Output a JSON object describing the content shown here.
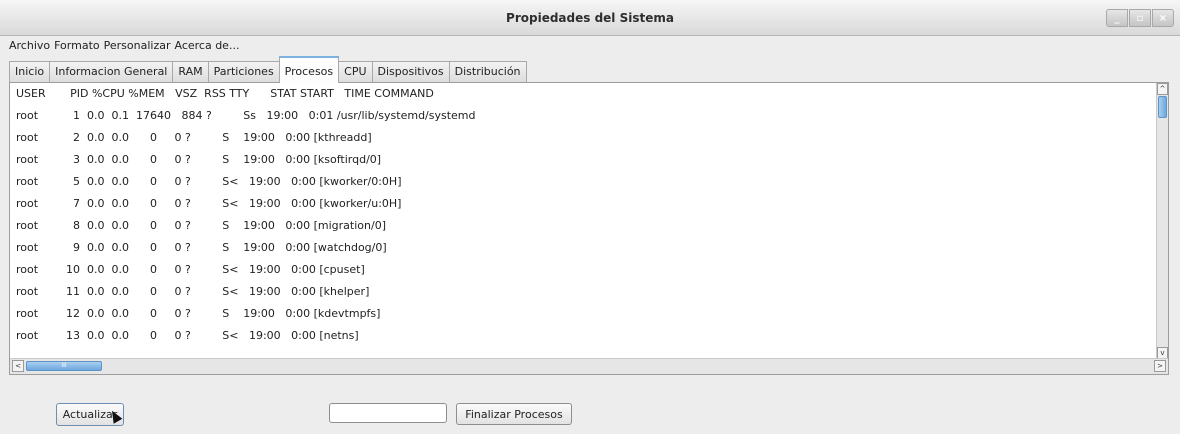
{
  "window": {
    "title": "Propiedades del Sistema",
    "controls": [
      "_",
      "▫",
      "×"
    ]
  },
  "menubar": [
    "Archivo",
    "Formato",
    "Personalizar",
    "Acerca de..."
  ],
  "tabs": [
    "Inicio",
    "Informacion General",
    "RAM",
    "Particiones",
    "Procesos",
    "CPU",
    "Dispositivos",
    "Distribución"
  ],
  "active_tab": "Procesos",
  "process_output": [
    "USER       PID %CPU %MEM   VSZ  RSS TTY      STAT START   TIME COMMAND",
    "root          1  0.0  0.1  17640   884 ?         Ss   19:00   0:01 /usr/lib/systemd/systemd",
    "root          2  0.0  0.0      0     0 ?         S    19:00   0:00 [kthreadd]",
    "root          3  0.0  0.0      0     0 ?         S    19:00   0:00 [ksoftirqd/0]",
    "root          5  0.0  0.0      0     0 ?         S<   19:00   0:00 [kworker/0:0H]",
    "root          7  0.0  0.0      0     0 ?         S<   19:00   0:00 [kworker/u:0H]",
    "root          8  0.0  0.0      0     0 ?         S    19:00   0:00 [migration/0]",
    "root          9  0.0  0.0      0     0 ?         S    19:00   0:00 [watchdog/0]",
    "root        10  0.0  0.0      0     0 ?         S<   19:00   0:00 [cpuset]",
    "root        11  0.0  0.0      0     0 ?         S<   19:00   0:00 [khelper]",
    "root        12  0.0  0.0      0     0 ?         S    19:00   0:00 [kdevtmpfs]",
    "root        13  0.0  0.0      0     0 ?         S<   19:00   0:00 [netns]"
  ],
  "buttons": {
    "refresh": "Actualizar",
    "kill": "Finalizar Procesos"
  },
  "pid_input": {
    "value": ""
  },
  "scroll_thumb_label": "III",
  "icons": {
    "scroll_up": "^",
    "scroll_down": "v",
    "scroll_left": "<",
    "scroll_right": ">"
  }
}
